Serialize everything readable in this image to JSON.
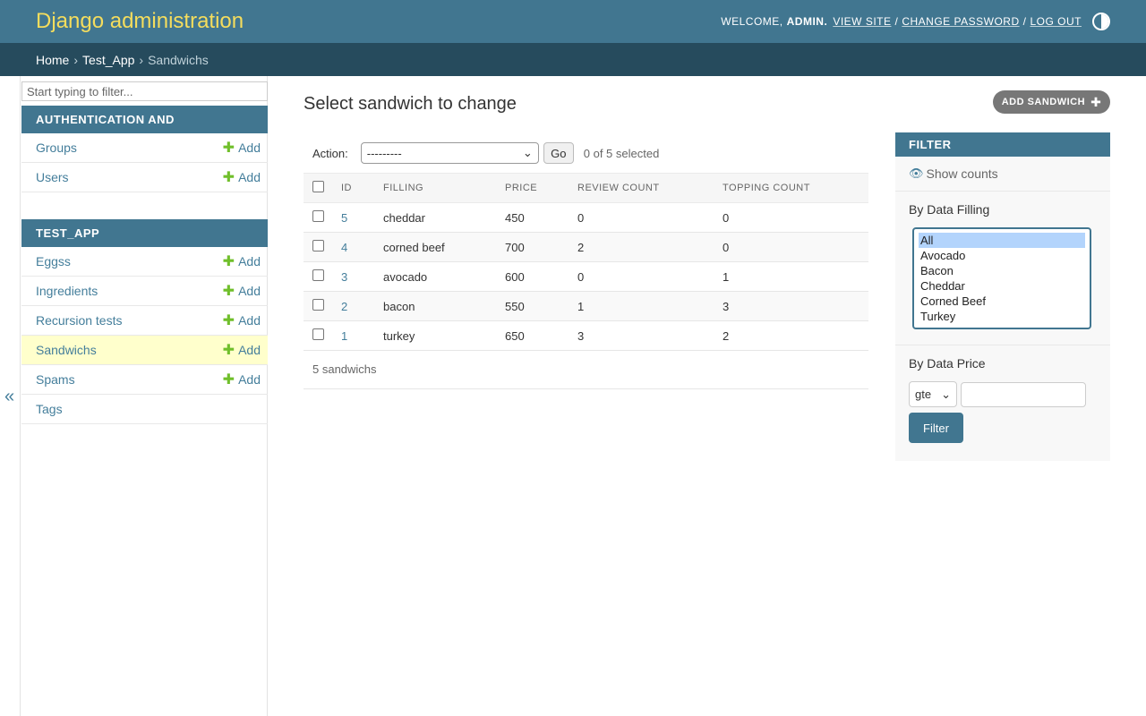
{
  "header": {
    "branding": "Django administration",
    "welcome": "WELCOME,",
    "username": "ADMIN.",
    "view_site": "VIEW SITE",
    "change_password": "CHANGE PASSWORD",
    "log_out": "LOG OUT",
    "separator": "/"
  },
  "breadcrumbs": {
    "home": "Home",
    "app": "Test_App",
    "current": "Sandwichs",
    "arrow": "›"
  },
  "sidebar": {
    "filter_placeholder": "Start typing to filter...",
    "collapse_glyph": "«",
    "add_label": "Add",
    "modules": [
      {
        "caption": "AUTHENTICATION AND AUTHORIZATION",
        "items": [
          {
            "label": "Groups",
            "has_add": true
          },
          {
            "label": "Users",
            "has_add": true
          }
        ]
      },
      {
        "caption": "TEST_APP",
        "items": [
          {
            "label": "Eggss",
            "has_add": true
          },
          {
            "label": "Ingredients",
            "has_add": true
          },
          {
            "label": "Recursion tests",
            "has_add": true
          },
          {
            "label": "Sandwichs",
            "has_add": true,
            "current": true
          },
          {
            "label": "Spams",
            "has_add": true
          },
          {
            "label": "Tags",
            "has_add": false
          }
        ]
      }
    ]
  },
  "main": {
    "title": "Select sandwich to change",
    "add_button": "ADD SANDWICH",
    "actions": {
      "label": "Action:",
      "selected_value": "---------",
      "go_label": "Go",
      "selection_count": "0 of 5 selected"
    },
    "table": {
      "columns": [
        "ID",
        "FILLING",
        "PRICE",
        "REVIEW COUNT",
        "TOPPING COUNT"
      ],
      "rows": [
        [
          "5",
          "cheddar",
          "450",
          "0",
          "0"
        ],
        [
          "4",
          "corned beef",
          "700",
          "2",
          "0"
        ],
        [
          "3",
          "avocado",
          "600",
          "0",
          "1"
        ],
        [
          "2",
          "bacon",
          "550",
          "1",
          "3"
        ],
        [
          "1",
          "turkey",
          "650",
          "3",
          "2"
        ]
      ]
    },
    "paginator": "5 sandwichs"
  },
  "filter": {
    "heading": "FILTER",
    "show_counts": "Show counts",
    "filling": {
      "title": "By Data Filling",
      "options": [
        "All",
        "Avocado",
        "Bacon",
        "Cheddar",
        "Corned Beef",
        "Turkey"
      ],
      "selected": "All"
    },
    "price": {
      "title": "By Data Price",
      "operator": "gte",
      "value": "",
      "button": "Filter"
    }
  },
  "colors": {
    "header": "#417690",
    "breadcrumbs": "#264b5d",
    "branding": "#f5dd5d",
    "link": "#447e9b",
    "add_green": "#70bf2b",
    "current_row": "#ffffcc"
  }
}
